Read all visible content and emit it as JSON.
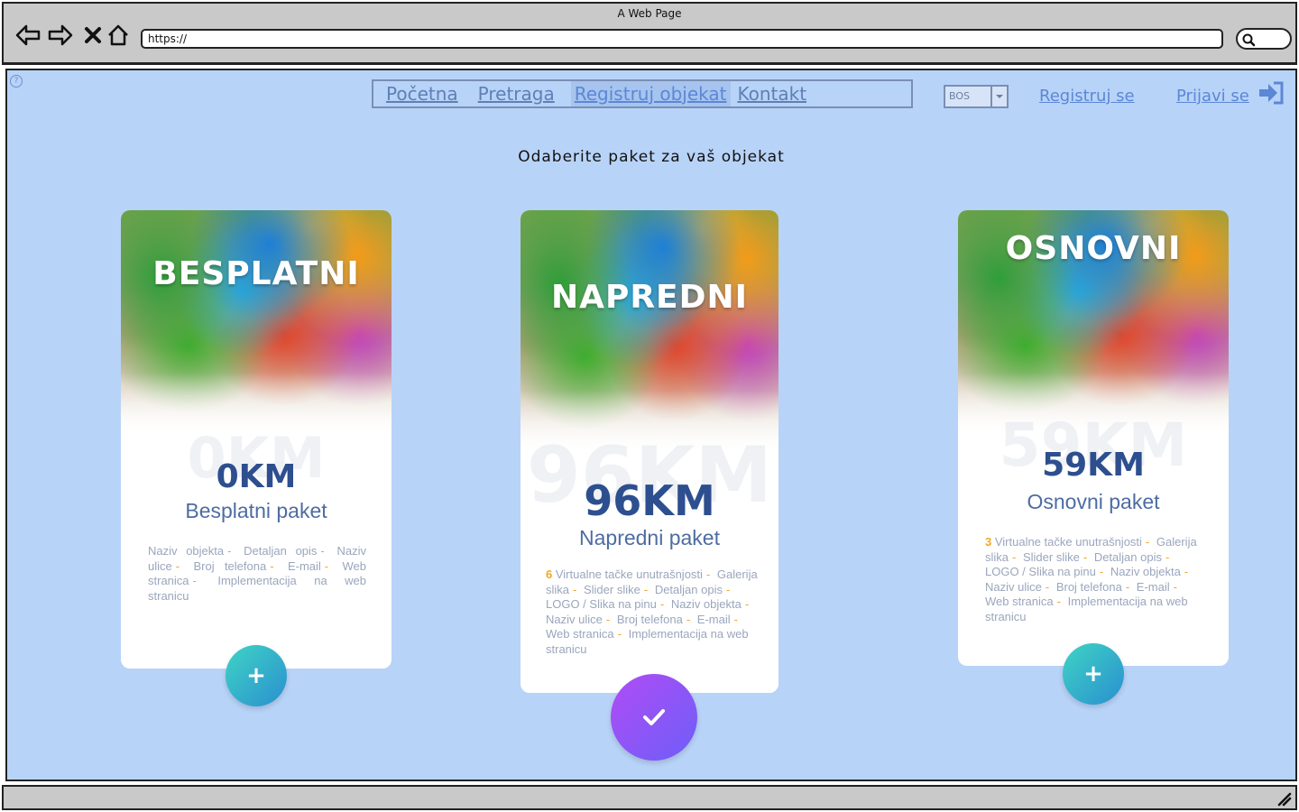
{
  "window": {
    "title": "A Web Page",
    "url": "https://"
  },
  "browser_icons": [
    "back-arrow-icon",
    "forward-arrow-icon",
    "close-x-icon",
    "home-icon",
    "search-icon"
  ],
  "nav": {
    "items": [
      "Početna",
      "Pretraga",
      "Registruj objekat",
      "Kontakt"
    ],
    "active_index": 2,
    "language": "BOS",
    "register": "Registruj se",
    "login": "Prijavi se"
  },
  "page": {
    "heading": "Odaberite paket za vaš objekat"
  },
  "cards": [
    {
      "title": "BESPLATNI",
      "ghost": "0KM",
      "price": "0KM",
      "package": "Besplatni paket",
      "features_prefix": "",
      "features": [
        "Naziv objekta",
        "Detaljan opis",
        "Naziv ulice",
        "Broj telefona",
        "E-mail",
        "Web stranica",
        "Implementacija na web stranicu"
      ],
      "button": "+"
    },
    {
      "title": "NAPREDNI",
      "ghost": "96KM",
      "price": "96KM",
      "package": "Napredni paket",
      "count": "6",
      "features": [
        "Virtualne tačke unutrašnjosti",
        "Galerija slika",
        "Slider slike",
        "Detaljan opis",
        "LOGO / Slika na pinu",
        "Naziv objekta",
        "Naziv ulice",
        "Broj telefona",
        "E-mail",
        "Web stranica",
        "Implementacija na web stranicu"
      ],
      "button": "✔"
    },
    {
      "title": "OSNOVNI",
      "ghost": "59KM",
      "price": "59KM",
      "package": "Osnovni paket",
      "count": "3",
      "features": [
        "Virtualne tačke unutrašnjosti",
        "Galerija slika",
        "Slider slike",
        "Detaljan opis",
        "LOGO / Slika na pinu",
        "Naziv objekta",
        "Naziv ulice",
        "Broj telefona",
        "E-mail",
        "Web stranica",
        "Implementacija na web stranicu"
      ],
      "button": "+"
    }
  ],
  "colors": {
    "page_background": "#b8d3f8",
    "nav_text": "#5f7fb5",
    "price_text": "#2d4f8f",
    "separator": "#f5a623",
    "plus_button": "#2a8fd0",
    "check_button": "#8a55f6"
  }
}
